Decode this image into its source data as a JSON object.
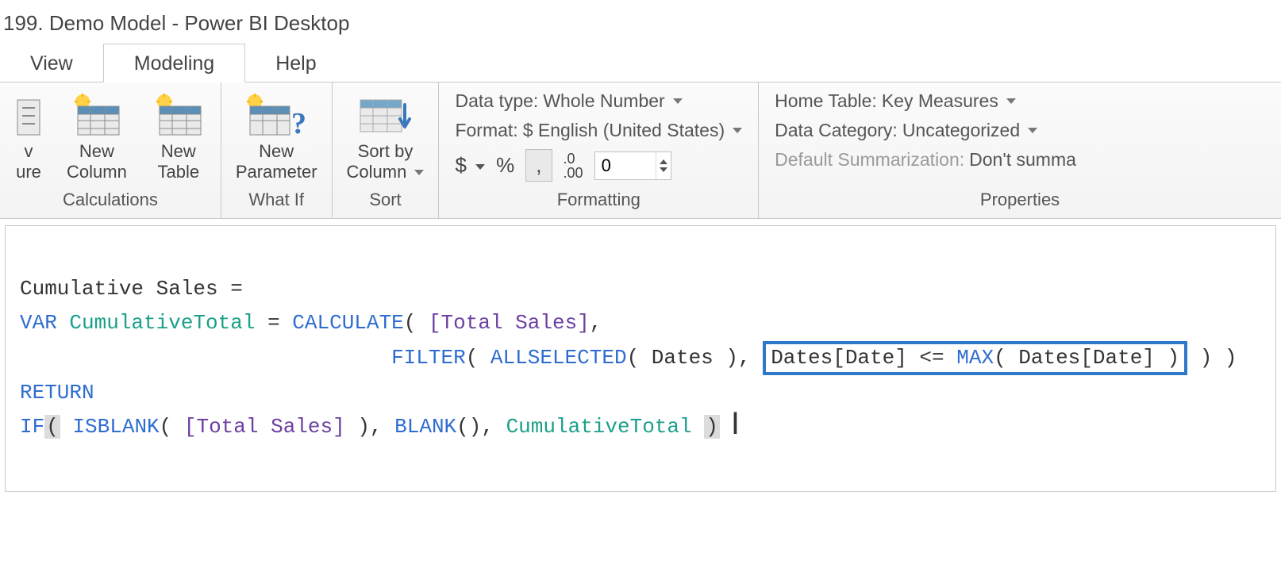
{
  "title": "199. Demo Model - Power BI Desktop",
  "tabs": {
    "view": "View",
    "modeling": "Modeling",
    "help": "Help",
    "active": "modeling"
  },
  "ribbon": {
    "calculations": {
      "label": "Calculations",
      "new_measure_l1": "v",
      "new_measure_l2": "ure",
      "new_column_l1": "New",
      "new_column_l2": "Column",
      "new_table_l1": "New",
      "new_table_l2": "Table"
    },
    "whatif": {
      "label": "What If",
      "new_parameter_l1": "New",
      "new_parameter_l2": "Parameter"
    },
    "sort": {
      "label": "Sort",
      "sort_by_column_l1": "Sort by",
      "sort_by_column_l2": "Column"
    },
    "formatting": {
      "label": "Formatting",
      "data_type_label": "Data type:",
      "data_type_value": "Whole Number",
      "format_label": "Format:",
      "format_value": "$ English (United States)",
      "currency_symbol": "$",
      "percent_symbol": "%",
      "comma_btn": ",",
      "decimal_btn": ".00",
      "decimal_btn_top": ".0",
      "places_value": "0"
    },
    "properties": {
      "label": "Properties",
      "home_table_label": "Home Table:",
      "home_table_value": "Key Measures",
      "data_category_label": "Data Category:",
      "data_category_value": "Uncategorized",
      "default_sum_label": "Default Summarization:",
      "default_sum_value": "Don't summa"
    }
  },
  "formula": {
    "line1_a": "Cumulative Sales = ",
    "line2_var": "VAR",
    "line2_name": "CumulativeTotal",
    "line2_eq": " = ",
    "line2_calc": "CALCULATE",
    "line2_open": "( ",
    "line2_measure": "[Total Sales]",
    "line2_comma": ",",
    "line3_pad": "                              ",
    "line3_filter": "FILTER",
    "line3_p1": "( ",
    "line3_allsel": "ALLSELECTED",
    "line3_p2": "( Dates ), ",
    "line3_box_a": "Dates[Date] <= ",
    "line3_box_max": "MAX",
    "line3_box_b": "( Dates[Date] )",
    "line3_tail": " ) )",
    "line4_return": "RETURN",
    "line5_if": "IF",
    "line5_open": "(",
    "line5_sp": " ",
    "line5_isblank": "ISBLANK",
    "line5_p1": "( ",
    "line5_measure": "[Total Sales]",
    "line5_p2": " ), ",
    "line5_blank": "BLANK",
    "line5_p3": "(), ",
    "line5_var": "CumulativeTotal",
    "line5_close": ")",
    "cursor_glyph": "I"
  }
}
